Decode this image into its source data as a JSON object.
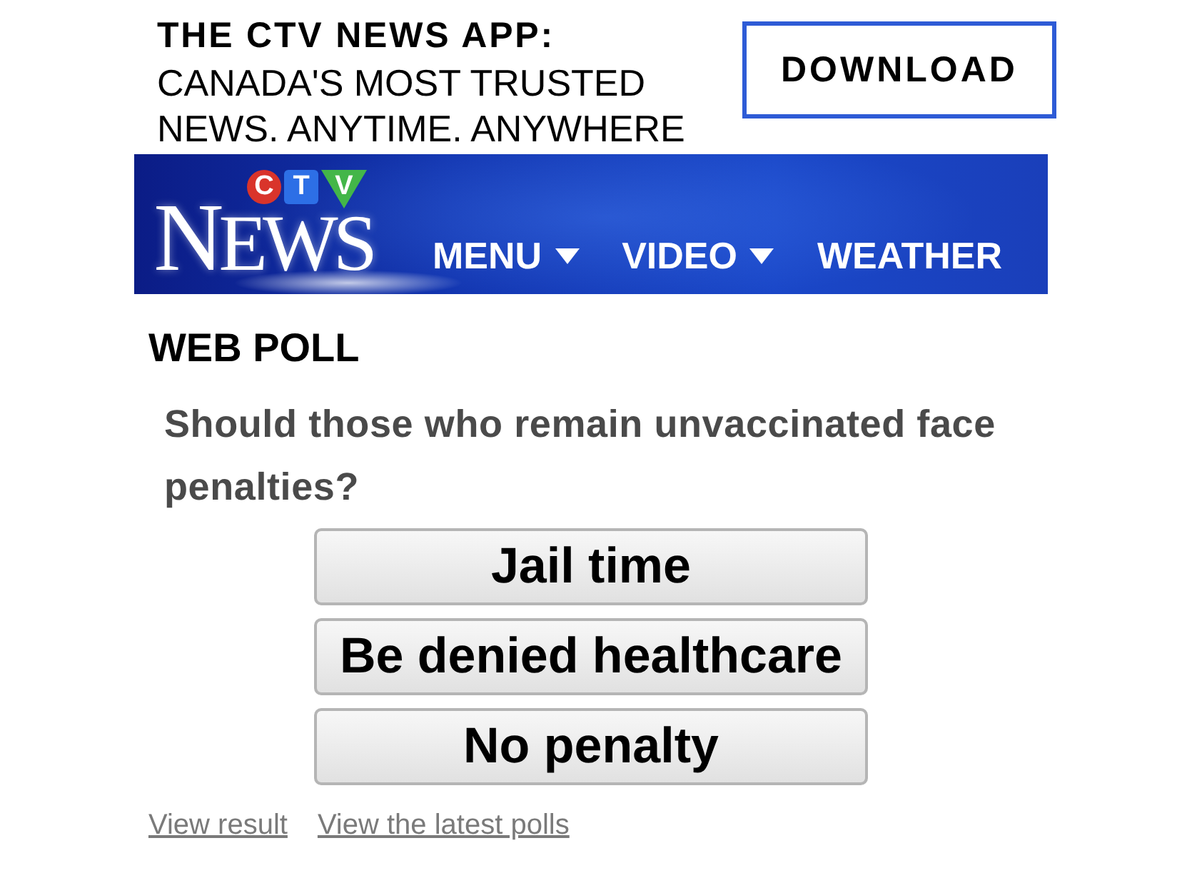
{
  "promo": {
    "headline": "THE CTV NEWS APP:",
    "tagline": "CANADA'S MOST TRUSTED NEWS. ANYTIME. ANYWHERE",
    "button": "DOWNLOAD"
  },
  "header": {
    "logo": {
      "letters": [
        {
          "letter": "C",
          "kind": "circle",
          "color": "#d9342b"
        },
        {
          "letter": "T",
          "kind": "square",
          "color": "#2d6fe6"
        },
        {
          "letter": "V",
          "kind": "triangle",
          "color": "#43b649"
        }
      ],
      "wordmark": "NEWS"
    },
    "nav": [
      {
        "label": "MENU",
        "dropdown": true
      },
      {
        "label": "VIDEO",
        "dropdown": true
      },
      {
        "label": "WEATHER",
        "dropdown": false
      }
    ]
  },
  "poll": {
    "title": "WEB POLL",
    "question": "Should those who remain unvaccinated face penalties?",
    "options": [
      "Jail time",
      "Be denied healthcare",
      "No penalty"
    ],
    "links": [
      "View result",
      "View the latest polls"
    ]
  }
}
